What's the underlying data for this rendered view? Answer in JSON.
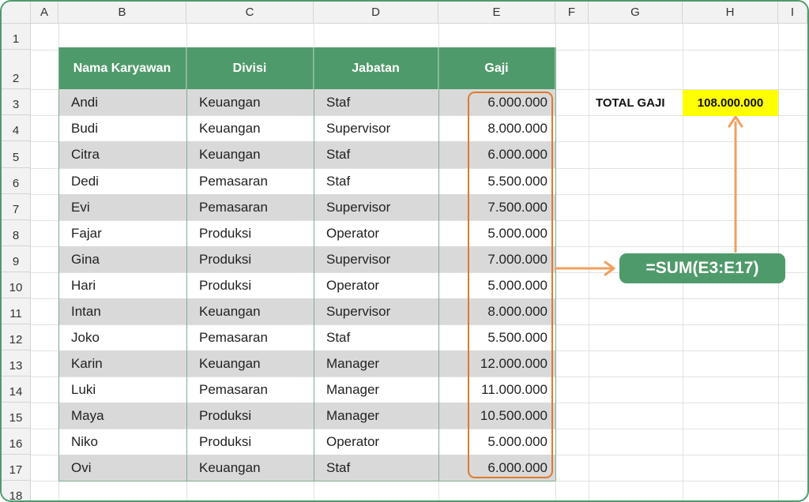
{
  "columns": [
    "A",
    "B",
    "C",
    "D",
    "E",
    "F",
    "G",
    "H",
    "I"
  ],
  "rows": [
    "1",
    "2",
    "3",
    "4",
    "5",
    "6",
    "7",
    "8",
    "9",
    "10",
    "11",
    "12",
    "13",
    "14",
    "15",
    "16",
    "17",
    "18"
  ],
  "table": {
    "headers": [
      "Nama Karyawan",
      "Divisi",
      "Jabatan",
      "Gaji"
    ],
    "rows": [
      [
        "Andi",
        "Keuangan",
        "Staf",
        "6.000.000"
      ],
      [
        "Budi",
        "Keuangan",
        "Supervisor",
        "8.000.000"
      ],
      [
        "Citra",
        "Keuangan",
        "Staf",
        "6.000.000"
      ],
      [
        "Dedi",
        "Pemasaran",
        "Staf",
        "5.500.000"
      ],
      [
        "Evi",
        "Pemasaran",
        "Supervisor",
        "7.500.000"
      ],
      [
        "Fajar",
        "Produksi",
        "Operator",
        "5.000.000"
      ],
      [
        "Gina",
        "Produksi",
        "Supervisor",
        "7.000.000"
      ],
      [
        "Hari",
        "Produksi",
        "Operator",
        "5.000.000"
      ],
      [
        "Intan",
        "Keuangan",
        "Supervisor",
        "8.000.000"
      ],
      [
        "Joko",
        "Pemasaran",
        "Staf",
        "5.500.000"
      ],
      [
        "Karin",
        "Keuangan",
        "Manager",
        "12.000.000"
      ],
      [
        "Luki",
        "Pemasaran",
        "Manager",
        "11.000.000"
      ],
      [
        "Maya",
        "Produksi",
        "Manager",
        "10.500.000"
      ],
      [
        "Niko",
        "Produksi",
        "Operator",
        "5.000.000"
      ],
      [
        "Ovi",
        "Keuangan",
        "Staf",
        "6.000.000"
      ]
    ]
  },
  "summary": {
    "label": "TOTAL GAJI",
    "value": "108.000.000"
  },
  "formula": "=SUM(E3:E17)",
  "colors": {
    "header_green": "#4f9a6b",
    "highlight_orange": "#e07a2a",
    "total_yellow": "#ffff00",
    "band_gray": "#d9d9d9"
  }
}
